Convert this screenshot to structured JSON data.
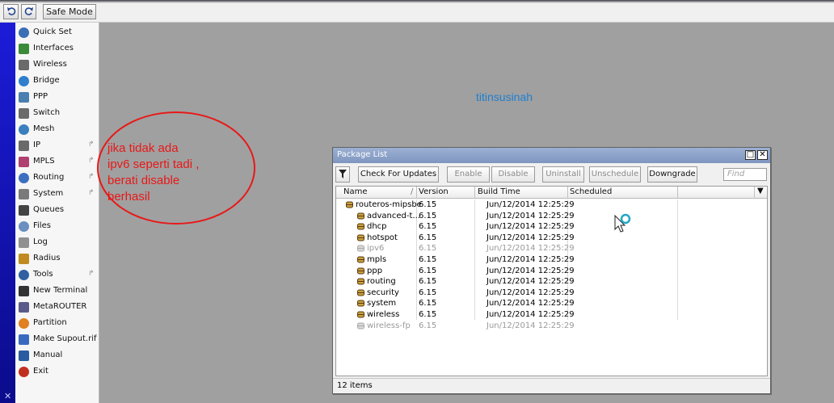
{
  "toolbar": {
    "undo_icon": "undo-icon",
    "redo_icon": "redo-icon",
    "safe_mode_label": "Safe Mode"
  },
  "sidebar": {
    "items": [
      {
        "label": "Quick Set",
        "icon": "magic-wand-icon",
        "submenu": false
      },
      {
        "label": "Interfaces",
        "icon": "interface-icon",
        "submenu": false
      },
      {
        "label": "Wireless",
        "icon": "antenna-icon",
        "submenu": false
      },
      {
        "label": "Bridge",
        "icon": "bridge-icon",
        "submenu": false
      },
      {
        "label": "PPP",
        "icon": "ppp-icon",
        "submenu": false
      },
      {
        "label": "Switch",
        "icon": "switch-icon",
        "submenu": false
      },
      {
        "label": "Mesh",
        "icon": "mesh-icon",
        "submenu": false
      },
      {
        "label": "IP",
        "icon": "ip-icon",
        "submenu": true
      },
      {
        "label": "MPLS",
        "icon": "mpls-icon",
        "submenu": true
      },
      {
        "label": "Routing",
        "icon": "routing-icon",
        "submenu": true
      },
      {
        "label": "System",
        "icon": "gear-icon",
        "submenu": true
      },
      {
        "label": "Queues",
        "icon": "queues-icon",
        "submenu": false
      },
      {
        "label": "Files",
        "icon": "folder-icon",
        "submenu": false
      },
      {
        "label": "Log",
        "icon": "log-icon",
        "submenu": false
      },
      {
        "label": "Radius",
        "icon": "radius-icon",
        "submenu": false
      },
      {
        "label": "Tools",
        "icon": "tools-icon",
        "submenu": true
      },
      {
        "label": "New Terminal",
        "icon": "terminal-icon",
        "submenu": false
      },
      {
        "label": "MetaROUTER",
        "icon": "metarouter-icon",
        "submenu": false
      },
      {
        "label": "Partition",
        "icon": "partition-icon",
        "submenu": false
      },
      {
        "label": "Make Supout.rif",
        "icon": "document-icon",
        "submenu": false
      },
      {
        "label": "Manual",
        "icon": "help-icon",
        "submenu": false
      },
      {
        "label": "Exit",
        "icon": "exit-icon",
        "submenu": false
      }
    ],
    "submenu_arrow": "↱"
  },
  "watermark": "titinsusinah",
  "annotation": {
    "lines": [
      "jika tidak ada",
      "ipv6 seperti tadi ,",
      "berati disable",
      "berhasil"
    ],
    "color": "#e81818"
  },
  "package_window": {
    "title": "Package List",
    "filter_icon": "filter-icon",
    "buttons": {
      "check_updates": "Check For Updates",
      "enable": "Enable",
      "disable": "Disable",
      "uninstall": "Uninstall",
      "unschedule": "Unschedule",
      "downgrade": "Downgrade"
    },
    "find_placeholder": "Find",
    "columns": {
      "name": "Name",
      "sort": "/",
      "version": "Version",
      "build_time": "Build Time",
      "scheduled": "Scheduled"
    },
    "rows": [
      {
        "name": "routeros-mipsbe",
        "version": "6.15",
        "build": "Jun/12/2014 12:25:29",
        "scheduled": "",
        "disabled": false,
        "level": 0
      },
      {
        "name": "advanced-t...",
        "version": "6.15",
        "build": "Jun/12/2014 12:25:29",
        "scheduled": "",
        "disabled": false,
        "level": 1
      },
      {
        "name": "dhcp",
        "version": "6.15",
        "build": "Jun/12/2014 12:25:29",
        "scheduled": "",
        "disabled": false,
        "level": 1
      },
      {
        "name": "hotspot",
        "version": "6.15",
        "build": "Jun/12/2014 12:25:29",
        "scheduled": "",
        "disabled": false,
        "level": 1
      },
      {
        "name": "ipv6",
        "version": "6.15",
        "build": "Jun/12/2014 12:25:29",
        "scheduled": "",
        "disabled": true,
        "level": 1
      },
      {
        "name": "mpls",
        "version": "6.15",
        "build": "Jun/12/2014 12:25:29",
        "scheduled": "",
        "disabled": false,
        "level": 1
      },
      {
        "name": "ppp",
        "version": "6.15",
        "build": "Jun/12/2014 12:25:29",
        "scheduled": "",
        "disabled": false,
        "level": 1
      },
      {
        "name": "routing",
        "version": "6.15",
        "build": "Jun/12/2014 12:25:29",
        "scheduled": "",
        "disabled": false,
        "level": 1
      },
      {
        "name": "security",
        "version": "6.15",
        "build": "Jun/12/2014 12:25:29",
        "scheduled": "",
        "disabled": false,
        "level": 1
      },
      {
        "name": "system",
        "version": "6.15",
        "build": "Jun/12/2014 12:25:29",
        "scheduled": "",
        "disabled": false,
        "level": 1
      },
      {
        "name": "wireless",
        "version": "6.15",
        "build": "Jun/12/2014 12:25:29",
        "scheduled": "",
        "disabled": false,
        "level": 1
      },
      {
        "name": "wireless-fp",
        "version": "6.15",
        "build": "Jun/12/2014 12:25:29",
        "scheduled": "",
        "disabled": true,
        "level": 1
      }
    ],
    "status": "12 items"
  },
  "colors": {
    "accent": "#0b0b8c",
    "title_bar": "#8ea3ca",
    "disabled_text": "#9a9a9a"
  }
}
